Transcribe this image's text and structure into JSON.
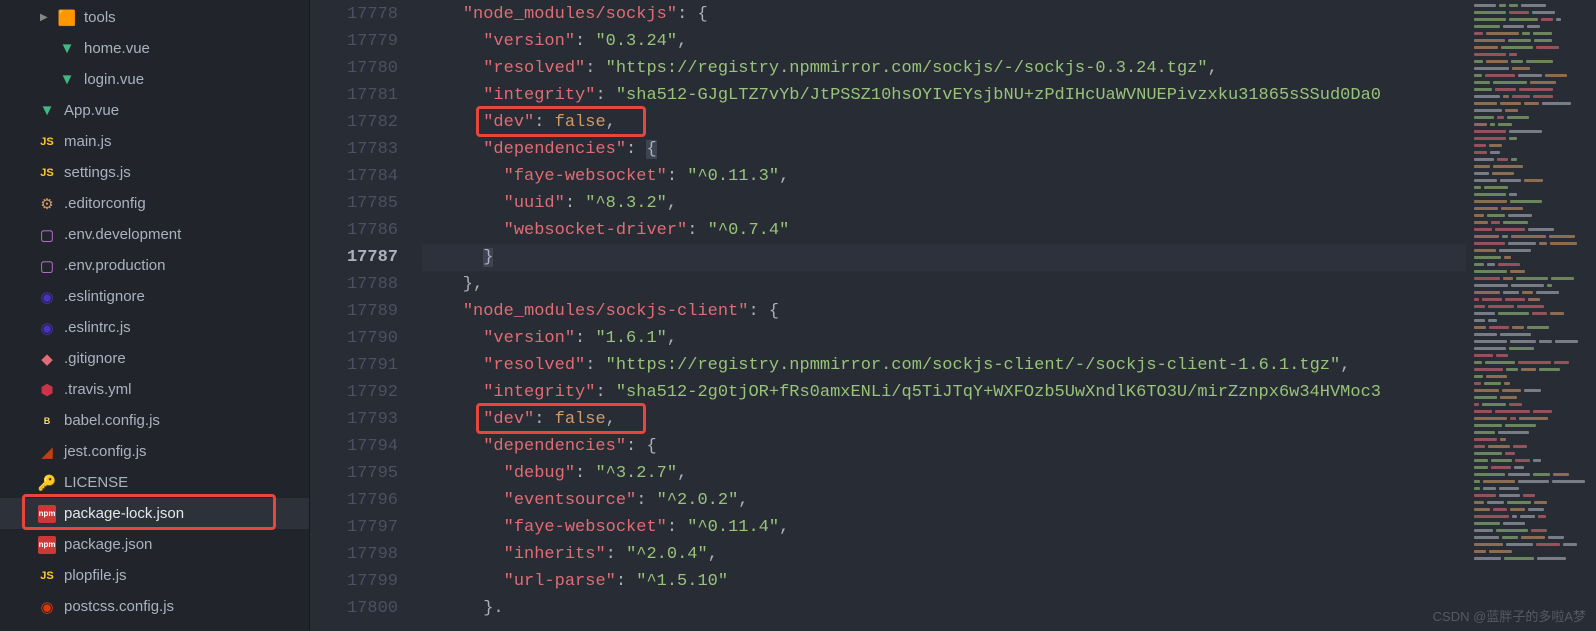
{
  "sidebar": {
    "items": [
      {
        "label": "tools",
        "indent": 1,
        "icon_type": "folder",
        "expandable": true
      },
      {
        "label": "home.vue",
        "indent": 1,
        "icon_type": "vue"
      },
      {
        "label": "login.vue",
        "indent": 1,
        "icon_type": "vue"
      },
      {
        "label": "App.vue",
        "indent": 0,
        "icon_type": "vue"
      },
      {
        "label": "main.js",
        "indent": 0,
        "icon_type": "js"
      },
      {
        "label": "settings.js",
        "indent": 0,
        "icon_type": "js"
      },
      {
        "label": ".editorconfig",
        "indent": 0,
        "icon_type": "config",
        "bold_section": true
      },
      {
        "label": ".env.development",
        "indent": 0,
        "icon_type": "env"
      },
      {
        "label": ".env.production",
        "indent": 0,
        "icon_type": "env"
      },
      {
        "label": ".eslintignore",
        "indent": 0,
        "icon_type": "eslint"
      },
      {
        "label": ".eslintrc.js",
        "indent": 0,
        "icon_type": "eslint"
      },
      {
        "label": ".gitignore",
        "indent": 0,
        "icon_type": "git"
      },
      {
        "label": ".travis.yml",
        "indent": 0,
        "icon_type": "travis"
      },
      {
        "label": "babel.config.js",
        "indent": 0,
        "icon_type": "babel"
      },
      {
        "label": "jest.config.js",
        "indent": 0,
        "icon_type": "jest"
      },
      {
        "label": "LICENSE",
        "indent": 0,
        "icon_type": "license"
      },
      {
        "label": "package-lock.json",
        "indent": 0,
        "icon_type": "npm",
        "active": true
      },
      {
        "label": "package.json",
        "indent": 0,
        "icon_type": "npm"
      },
      {
        "label": "plopfile.js",
        "indent": 0,
        "icon_type": "js"
      },
      {
        "label": "postcss.config.js",
        "indent": 0,
        "icon_type": "postcss"
      }
    ]
  },
  "editor": {
    "lines": [
      {
        "num": "17778",
        "tokens": [
          [
            "    ",
            ""
          ],
          [
            "\"node_modules/sockjs\"",
            "key"
          ],
          [
            ": {",
            "punc"
          ]
        ]
      },
      {
        "num": "17779",
        "tokens": [
          [
            "      ",
            ""
          ],
          [
            "\"version\"",
            "key"
          ],
          [
            ": ",
            "punc"
          ],
          [
            "\"0.3.24\"",
            "str"
          ],
          [
            ",",
            "punc"
          ]
        ]
      },
      {
        "num": "17780",
        "tokens": [
          [
            "      ",
            ""
          ],
          [
            "\"resolved\"",
            "key"
          ],
          [
            ": ",
            "punc"
          ],
          [
            "\"https://registry.npmmirror.com/sockjs/-/sockjs-0.3.24.tgz\"",
            "str"
          ],
          [
            ",",
            "punc"
          ]
        ]
      },
      {
        "num": "17781",
        "tokens": [
          [
            "      ",
            ""
          ],
          [
            "\"integrity\"",
            "key"
          ],
          [
            ": ",
            "punc"
          ],
          [
            "\"sha512-GJgLTZ7vYb/JtPSSZ10hsOYIvEYsjbNU+zPdIHcUaWVNUEPivzxku31865sSSud0Da0",
            "str"
          ]
        ]
      },
      {
        "num": "17782",
        "tokens": [
          [
            "      ",
            ""
          ],
          [
            "\"dev\"",
            "key"
          ],
          [
            ": ",
            "punc"
          ],
          [
            "false",
            "bool"
          ],
          [
            ",",
            "punc"
          ]
        ],
        "box": 1
      },
      {
        "num": "17783",
        "tokens": [
          [
            "      ",
            ""
          ],
          [
            "\"dependencies\"",
            "key"
          ],
          [
            ": ",
            "punc"
          ],
          [
            "{",
            "punc",
            "sel"
          ]
        ]
      },
      {
        "num": "17784",
        "tokens": [
          [
            "        ",
            ""
          ],
          [
            "\"faye-websocket\"",
            "key"
          ],
          [
            ": ",
            "punc"
          ],
          [
            "\"^0.11.3\"",
            "str"
          ],
          [
            ",",
            "punc"
          ]
        ]
      },
      {
        "num": "17785",
        "tokens": [
          [
            "        ",
            ""
          ],
          [
            "\"uuid\"",
            "key"
          ],
          [
            ": ",
            "punc"
          ],
          [
            "\"^8.3.2\"",
            "str"
          ],
          [
            ",",
            "punc"
          ]
        ]
      },
      {
        "num": "17786",
        "tokens": [
          [
            "        ",
            ""
          ],
          [
            "\"websocket-driver\"",
            "key"
          ],
          [
            ": ",
            "punc"
          ],
          [
            "\"^0.7.4\"",
            "str"
          ]
        ]
      },
      {
        "num": "17787",
        "tokens": [
          [
            "      ",
            ""
          ],
          [
            "}",
            "punc",
            "sel"
          ]
        ],
        "active": true
      },
      {
        "num": "17788",
        "tokens": [
          [
            "    },",
            ""
          ]
        ]
      },
      {
        "num": "17789",
        "tokens": [
          [
            "    ",
            ""
          ],
          [
            "\"node_modules/sockjs-client\"",
            "key"
          ],
          [
            ": {",
            "punc"
          ]
        ]
      },
      {
        "num": "17790",
        "tokens": [
          [
            "      ",
            ""
          ],
          [
            "\"version\"",
            "key"
          ],
          [
            ": ",
            "punc"
          ],
          [
            "\"1.6.1\"",
            "str"
          ],
          [
            ",",
            "punc"
          ]
        ]
      },
      {
        "num": "17791",
        "tokens": [
          [
            "      ",
            ""
          ],
          [
            "\"resolved\"",
            "key"
          ],
          [
            ": ",
            "punc"
          ],
          [
            "\"https://registry.npmmirror.com/sockjs-client/-/sockjs-client-1.6.1.tgz\"",
            "str"
          ],
          [
            ",",
            "punc"
          ]
        ]
      },
      {
        "num": "17792",
        "tokens": [
          [
            "      ",
            ""
          ],
          [
            "\"integrity\"",
            "key"
          ],
          [
            ": ",
            "punc"
          ],
          [
            "\"sha512-2g0tjOR+fRs0amxENLi/q5TiJTqY+WXFOzb5UwXndlK6TO3U/mirZznpx6w34HVMoc3",
            "str"
          ]
        ]
      },
      {
        "num": "17793",
        "tokens": [
          [
            "      ",
            ""
          ],
          [
            "\"dev\"",
            "key"
          ],
          [
            ": ",
            "punc"
          ],
          [
            "false",
            "bool"
          ],
          [
            ",",
            "punc"
          ]
        ],
        "box": 2
      },
      {
        "num": "17794",
        "tokens": [
          [
            "      ",
            ""
          ],
          [
            "\"dependencies\"",
            "key"
          ],
          [
            ": {",
            "punc"
          ]
        ]
      },
      {
        "num": "17795",
        "tokens": [
          [
            "        ",
            ""
          ],
          [
            "\"debug\"",
            "key"
          ],
          [
            ": ",
            "punc"
          ],
          [
            "\"^3.2.7\"",
            "str"
          ],
          [
            ",",
            "punc"
          ]
        ]
      },
      {
        "num": "17796",
        "tokens": [
          [
            "        ",
            ""
          ],
          [
            "\"eventsource\"",
            "key"
          ],
          [
            ": ",
            "punc"
          ],
          [
            "\"^2.0.2\"",
            "str"
          ],
          [
            ",",
            "punc"
          ]
        ]
      },
      {
        "num": "17797",
        "tokens": [
          [
            "        ",
            ""
          ],
          [
            "\"faye-websocket\"",
            "key"
          ],
          [
            ": ",
            "punc"
          ],
          [
            "\"^0.11.4\"",
            "str"
          ],
          [
            ",",
            "punc"
          ]
        ]
      },
      {
        "num": "17798",
        "tokens": [
          [
            "        ",
            ""
          ],
          [
            "\"inherits\"",
            "key"
          ],
          [
            ": ",
            "punc"
          ],
          [
            "\"^2.0.4\"",
            "str"
          ],
          [
            ",",
            "punc"
          ]
        ]
      },
      {
        "num": "17799",
        "tokens": [
          [
            "        ",
            ""
          ],
          [
            "\"url-parse\"",
            "key"
          ],
          [
            ": ",
            "punc"
          ],
          [
            "\"^1.5.10\"",
            "str"
          ]
        ]
      },
      {
        "num": "17800",
        "tokens": [
          [
            "      }.",
            "punc"
          ]
        ]
      }
    ]
  },
  "watermark": "CSDN @蓝胖子的多啦A梦",
  "highlights": {
    "sidebar_box": {
      "top_idx": 16
    },
    "code_box_1": {
      "line_idx": 4
    },
    "code_box_2": {
      "line_idx": 15
    }
  }
}
